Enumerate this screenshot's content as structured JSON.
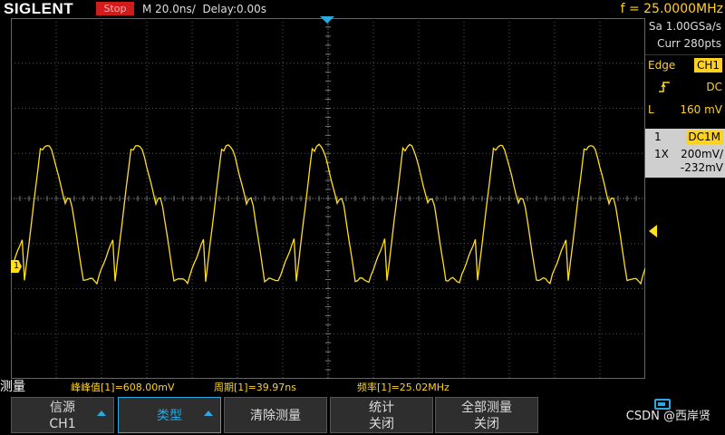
{
  "header": {
    "brand": "SIGLENT",
    "run_state": "Stop",
    "timebase": "M 20.0ns/",
    "delay": "Delay:0.00s",
    "frequency": "f = 25.0000MHz"
  },
  "acquisition": {
    "sample_rate": "Sa 1.00GSa/s",
    "memory_depth": "Curr 280pts"
  },
  "trigger": {
    "type": "Edge",
    "source": "CH1",
    "slope_icon": "rising-edge-icon",
    "coupling": "DC",
    "level_label": "L",
    "level": "160 mV"
  },
  "channel": {
    "number": "1",
    "coupling": "DC1M",
    "probe": "1X",
    "scale": "200mV/",
    "offset": "-232mV",
    "marker": "1"
  },
  "measurements": {
    "title": "测量",
    "items": [
      "峰峰值[1]=608.00mV",
      "周期[1]=39.97ns",
      "频率[1]=25.02MHz"
    ]
  },
  "softkeys": [
    {
      "line1": "信源",
      "line2": "CH1"
    },
    {
      "line1": "类型",
      "line2": ""
    },
    {
      "line1": "清除测量",
      "line2": ""
    },
    {
      "line1": "统计",
      "line2": "关闭"
    },
    {
      "line1": "全部测量",
      "line2": "关闭"
    }
  ],
  "watermark": "CSDN @西岸贤",
  "colors": {
    "trace": "#ffe01a",
    "accent": "#2aa8e0",
    "stop": "#d21c1c"
  },
  "waveform": {
    "cycles": 7,
    "points_per_cycle": 40
  }
}
